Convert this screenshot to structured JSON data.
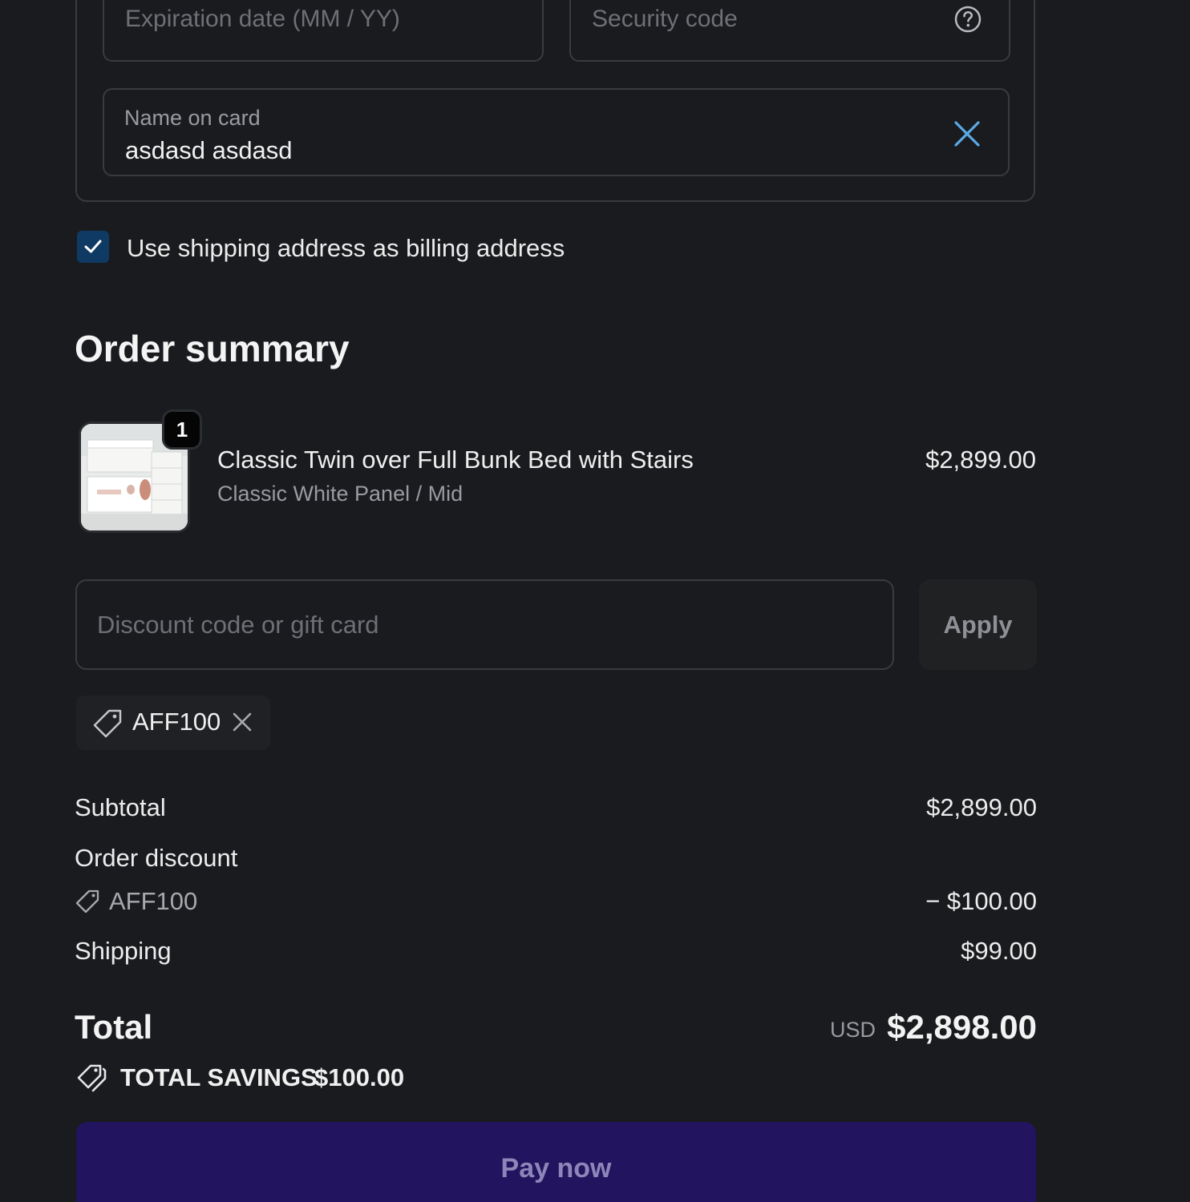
{
  "payment": {
    "expiration_placeholder": "Expiration date (MM / YY)",
    "security_placeholder": "Security code",
    "name_label": "Name on card",
    "name_value": "asdasd asdasd"
  },
  "billing": {
    "checkbox_label": "Use shipping address as billing address",
    "checked": true
  },
  "summary": {
    "title": "Order summary",
    "item": {
      "quantity": "1",
      "name": "Classic Twin over Full Bunk Bed with Stairs",
      "variant": "Classic White Panel / Mid",
      "price": "$2,899.00"
    },
    "discount_placeholder": "Discount code or gift card",
    "apply_label": "Apply",
    "applied_code": "AFF100",
    "subtotal_label": "Subtotal",
    "subtotal_value": "$2,899.00",
    "discount_label": "Order discount",
    "discount_code": "AFF100",
    "discount_value": "− $100.00",
    "shipping_label": "Shipping",
    "shipping_value": "$99.00",
    "total_label": "Total",
    "currency": "USD",
    "total_value": "$2,898.00",
    "savings_label": "TOTAL SAVINGS",
    "savings_value": "$100.00",
    "pay_label": "Pay now"
  },
  "colors": {
    "background": "#1a1b1e",
    "checkbox": "#0f3a63",
    "pay_button": "#22145f",
    "accent_clear": "#5aa9e6"
  },
  "icons": [
    "help-icon",
    "clear-icon",
    "check-icon",
    "tag-icon",
    "close-icon",
    "tags-icon"
  ]
}
